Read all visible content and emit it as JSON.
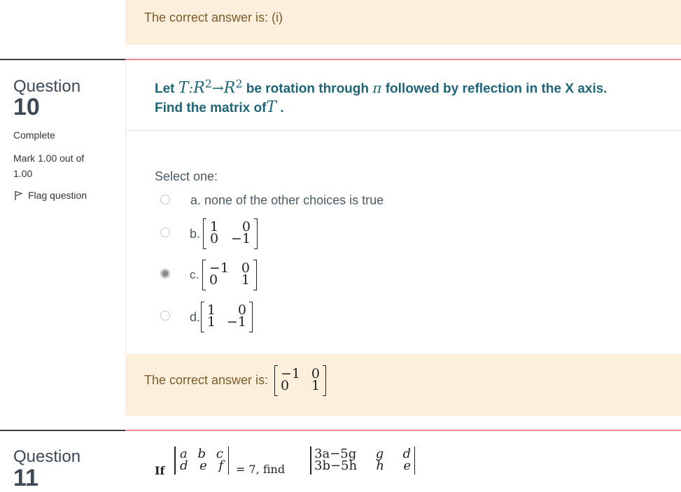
{
  "prev_feedback": {
    "text": "The correct answer is: (i)"
  },
  "question": {
    "word": "Question",
    "number": "10",
    "state": "Complete",
    "mark_line1": "Mark 1.00 out of",
    "mark_line2": "1.00",
    "flag_label": "Flag question",
    "text": {
      "let": "Let",
      "T": "T",
      "colon": ":",
      "R1": "R",
      "exp1": "2",
      "arrow": "→",
      "R2": "R",
      "exp2": "2",
      "middle": "be rotation through",
      "pi": "π",
      "tail": "followed by reflection in the X axis.",
      "find": "Find the matrix of",
      "T2": "T",
      "period": "."
    },
    "select_one": "Select one:",
    "options": [
      {
        "label": "a. none of the other choices is true",
        "matrix": null,
        "checked": false
      },
      {
        "label": "b.",
        "matrix": [
          [
            "1",
            "0"
          ],
          [
            "0",
            "−1"
          ]
        ],
        "checked": false
      },
      {
        "label": "c.",
        "matrix": [
          [
            "−1",
            "0"
          ],
          [
            "0",
            "1"
          ]
        ],
        "checked": true
      },
      {
        "label": "d.",
        "matrix": [
          [
            "1",
            "0"
          ],
          [
            "1",
            "−1"
          ]
        ],
        "checked": false
      }
    ],
    "feedback": {
      "text": "The correct answer is:",
      "matrix": [
        [
          "−1",
          "0"
        ],
        [
          "0",
          "1"
        ]
      ]
    }
  },
  "next_question": {
    "word": "Question",
    "number": "11",
    "text_if": "If",
    "det1": [
      [
        "a",
        "b",
        "c"
      ],
      [
        "d",
        "e",
        "f"
      ]
    ],
    "eq": "= 7, find",
    "det2": [
      [
        "3a−5g",
        "g",
        "d"
      ],
      [
        "3b−5h",
        "h",
        "e"
      ]
    ]
  }
}
